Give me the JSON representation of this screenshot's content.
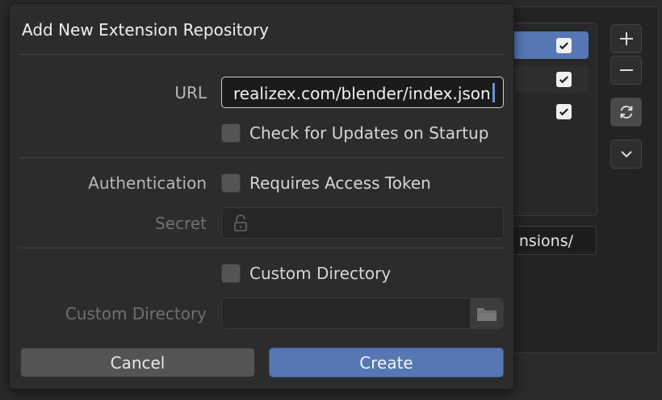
{
  "dialog": {
    "title": "Add New Extension Repository",
    "url_label": "URL",
    "url_value": "realizex.com/blender/index.json",
    "check_updates_label": "Check for Updates on Startup",
    "authentication_label": "Authentication",
    "requires_token_label": "Requires Access Token",
    "secret_label": "Secret",
    "custom_dir_checkbox_label": "Custom Directory",
    "custom_dir_field_label": "Custom Directory",
    "cancel_label": "Cancel",
    "create_label": "Create"
  },
  "background": {
    "path_text": "nsions/",
    "repo_checks": [
      true,
      true,
      true
    ]
  },
  "colors": {
    "accent": "#5677b3",
    "dialog_bg": "#2c2c2c",
    "field_bg": "#1b1b1b"
  },
  "icons": {
    "add": "plus-icon",
    "remove": "minus-icon",
    "refresh": "refresh-icon",
    "more": "chevron-down-icon",
    "secret": "lock-icon",
    "browse": "folder-icon"
  }
}
